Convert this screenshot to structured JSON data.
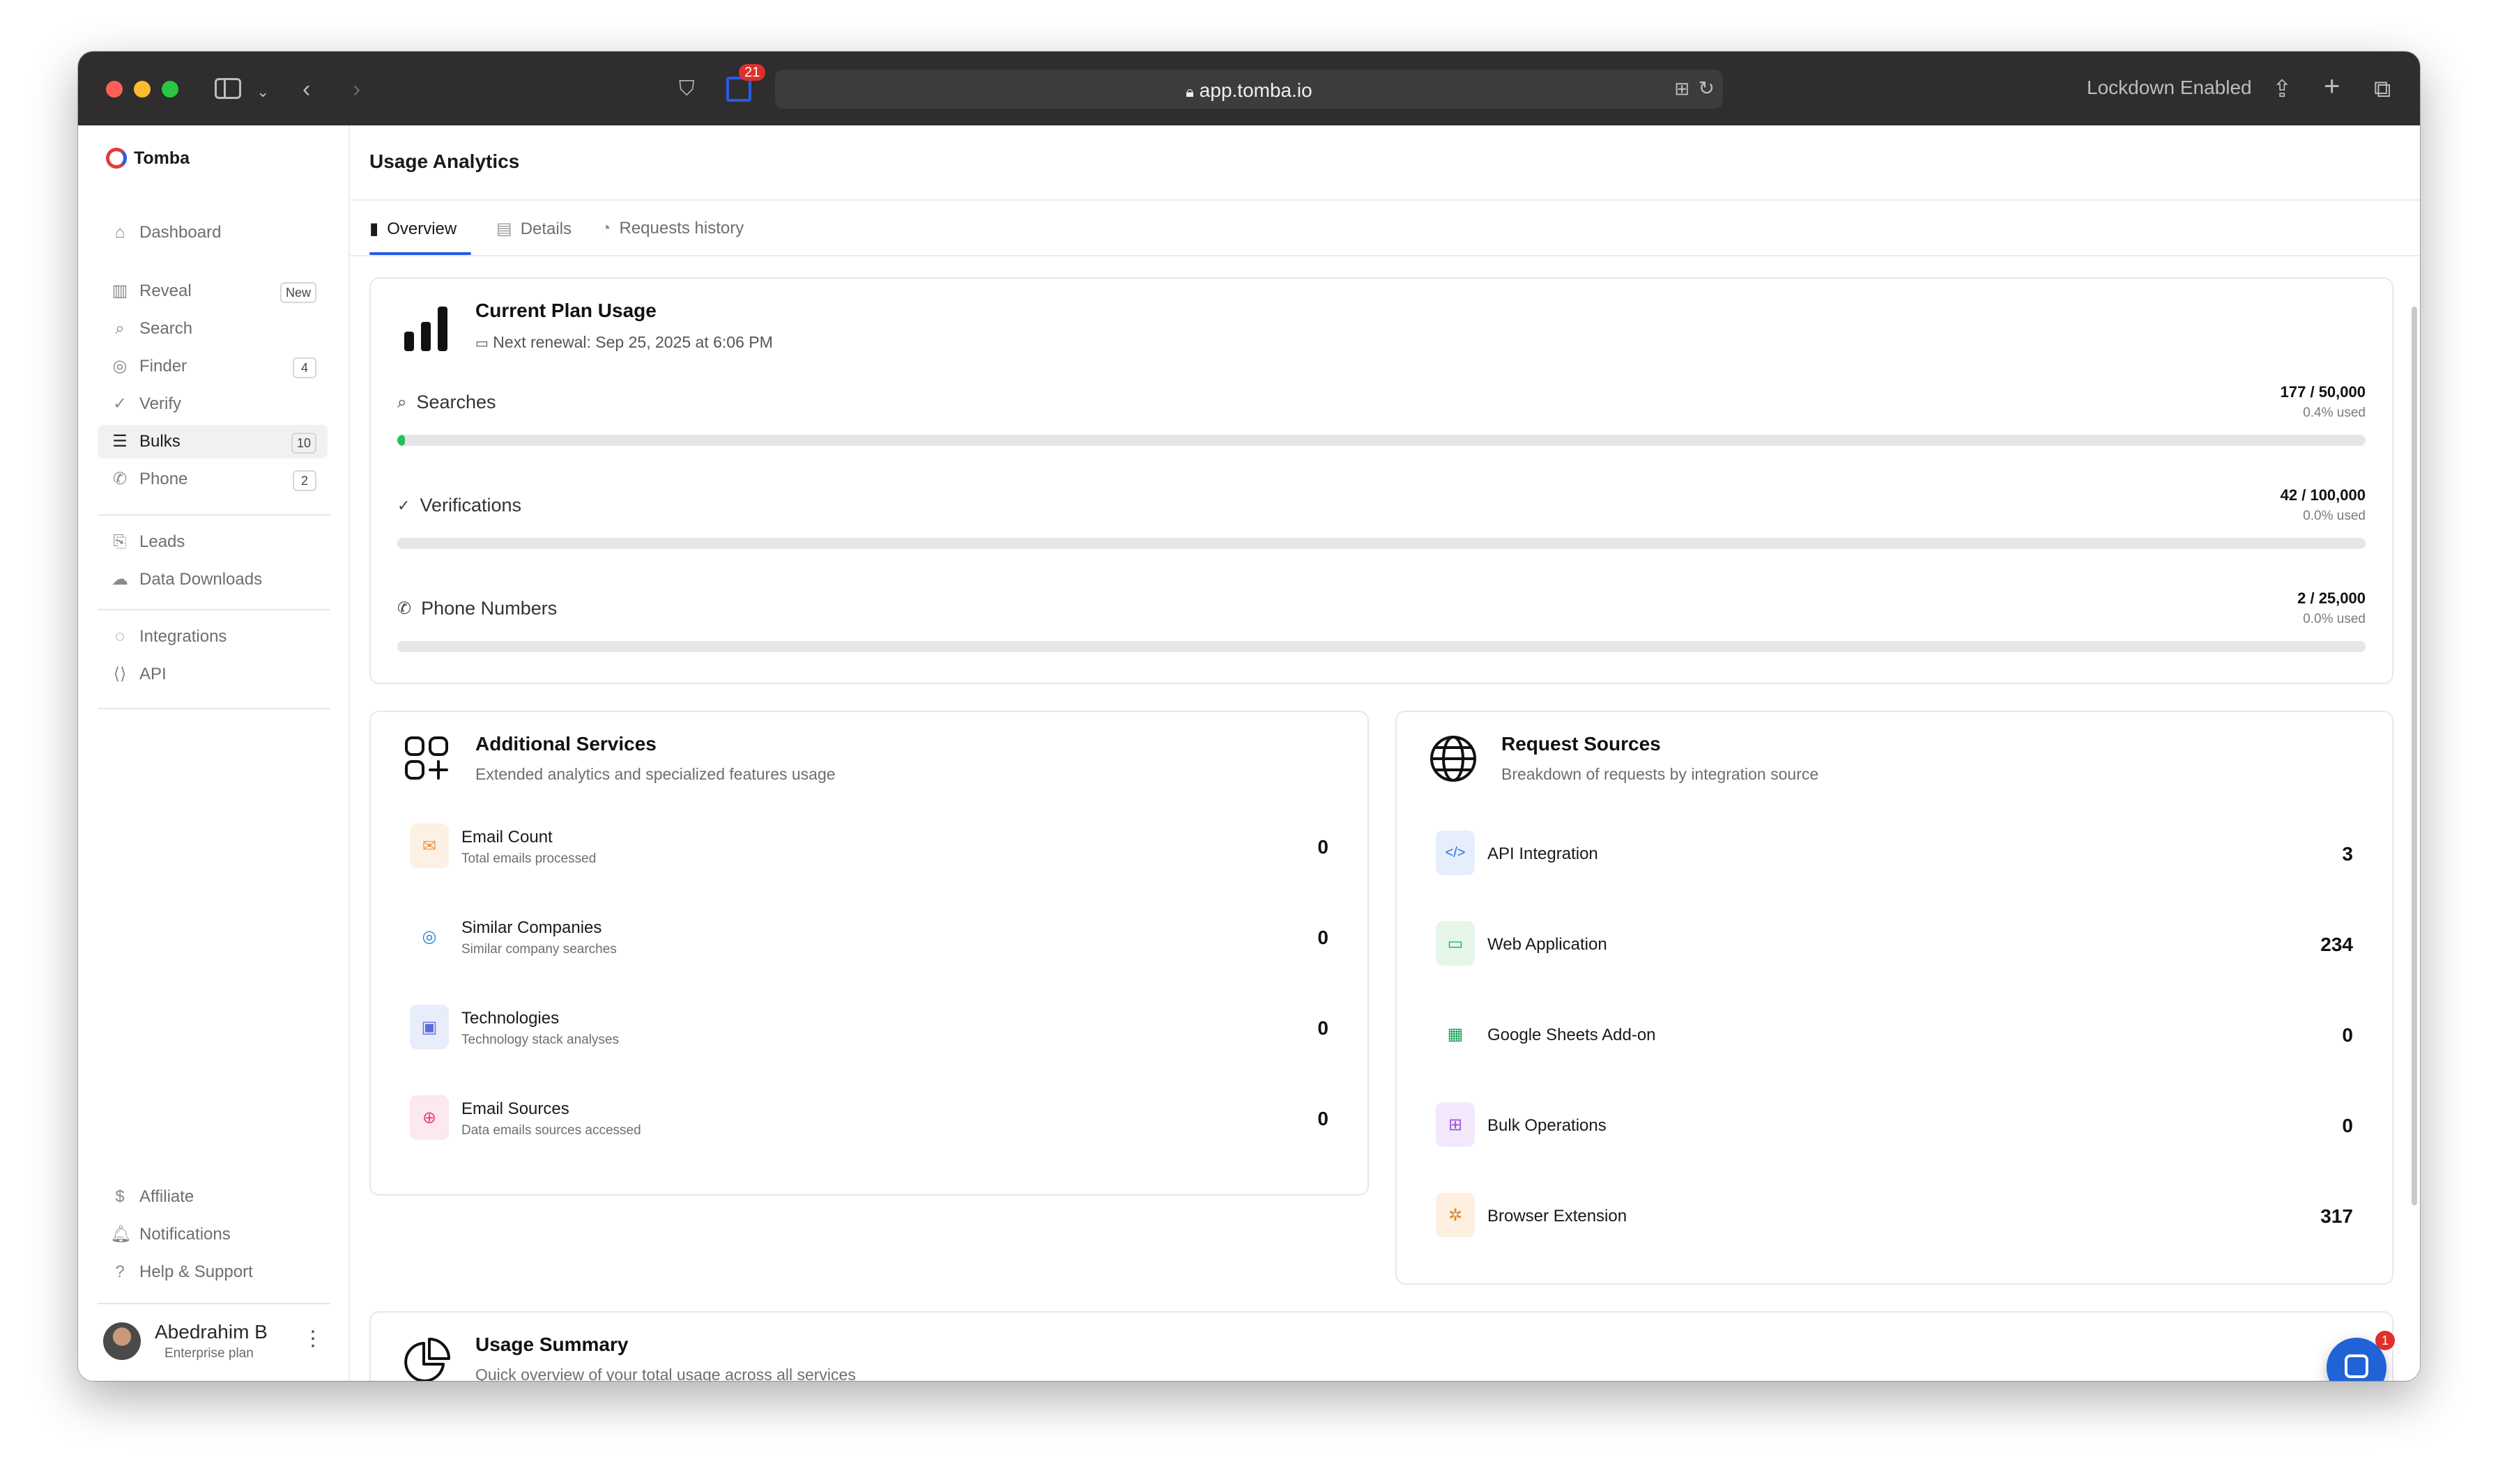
{
  "browser": {
    "url": "app.tomba.io",
    "extension_badge": "21",
    "lockdown": "Lockdown Enabled"
  },
  "sidebar": {
    "brand": "Tomba",
    "items": [
      {
        "label": "Dashboard",
        "icon": "home-icon"
      },
      {
        "label": "Reveal",
        "icon": "building-icon",
        "badge": "New"
      },
      {
        "label": "Search",
        "icon": "search-icon"
      },
      {
        "label": "Finder",
        "icon": "user-circle-icon",
        "badge": "4"
      },
      {
        "label": "Verify",
        "icon": "check-circle-icon"
      },
      {
        "label": "Bulks",
        "icon": "list-icon",
        "badge": "10",
        "active": true
      },
      {
        "label": "Phone",
        "icon": "phone-icon",
        "badge": "2"
      },
      {
        "label": "Leads",
        "icon": "file-plus-icon"
      },
      {
        "label": "Data Downloads",
        "icon": "cloud-icon"
      },
      {
        "label": "Integrations",
        "icon": "fingerprint-icon"
      },
      {
        "label": "API",
        "icon": "code-icon"
      },
      {
        "label": "Affiliate",
        "icon": "dollar-icon"
      },
      {
        "label": "Notifications",
        "icon": "bell-icon"
      },
      {
        "label": "Help & Support",
        "icon": "help-icon"
      }
    ],
    "user": {
      "name": "Abedrahim B",
      "plan": "Enterprise plan"
    }
  },
  "main": {
    "title": "Usage Analytics",
    "tabs": [
      {
        "label": "Overview",
        "active": true
      },
      {
        "label": "Details"
      },
      {
        "label": "Requests history"
      }
    ],
    "plan_usage": {
      "title": "Current Plan Usage",
      "renewal": "Next renewal: Sep 25, 2025 at 6:06 PM",
      "rows": [
        {
          "label": "Searches",
          "value": "177 / 50,000",
          "pct": "0.4% used",
          "fraction": 0.004
        },
        {
          "label": "Verifications",
          "value": "42 / 100,000",
          "pct": "0.0% used",
          "fraction": 0.0
        },
        {
          "label": "Phone Numbers",
          "value": "2 / 25,000",
          "pct": "0.0% used",
          "fraction": 0.0
        }
      ]
    },
    "additional_services": {
      "title": "Additional Services",
      "subtitle": "Extended analytics and specialized features usage",
      "rows": [
        {
          "name": "Email Count",
          "desc": "Total emails processed",
          "value": "0",
          "icon": "mail-icon",
          "color": "#f0923a",
          "bg": "#fdf0e4"
        },
        {
          "name": "Similar Companies",
          "desc": "Similar company searches",
          "value": "0",
          "icon": "fingerprint-icon",
          "color": "#2b7fd6",
          "bg": "#ffffff"
        },
        {
          "name": "Technologies",
          "desc": "Technology stack analyses",
          "value": "0",
          "icon": "cpu-icon",
          "color": "#5a6ee0",
          "bg": "#e8ecfb"
        },
        {
          "name": "Email Sources",
          "desc": "Data emails sources accessed",
          "value": "0",
          "icon": "globe-icon",
          "color": "#e0457a",
          "bg": "#fce8ef"
        }
      ]
    },
    "request_sources": {
      "title": "Request Sources",
      "subtitle": "Breakdown of requests by integration source",
      "rows": [
        {
          "name": "API Integration",
          "value": "3",
          "icon": "code-icon",
          "color": "#2b6ad6",
          "bg": "#e6eefc"
        },
        {
          "name": "Web Application",
          "value": "234",
          "icon": "monitor-icon",
          "color": "#23a655",
          "bg": "#e4f7ea"
        },
        {
          "name": "Google Sheets Add-on",
          "value": "0",
          "icon": "sheet-icon",
          "color": "#1e9e5a",
          "bg": "#ffffff"
        },
        {
          "name": "Bulk Operations",
          "value": "0",
          "icon": "grid-plus-icon",
          "color": "#9a55d8",
          "bg": "#f3e8fc"
        },
        {
          "name": "Browser Extension",
          "value": "317",
          "icon": "puzzle-icon",
          "color": "#e0862e",
          "bg": "#fdf0e0"
        }
      ]
    },
    "usage_summary": {
      "title": "Usage Summary",
      "subtitle": "Quick overview of your total usage across all services"
    }
  },
  "chat": {
    "badge": "1"
  }
}
